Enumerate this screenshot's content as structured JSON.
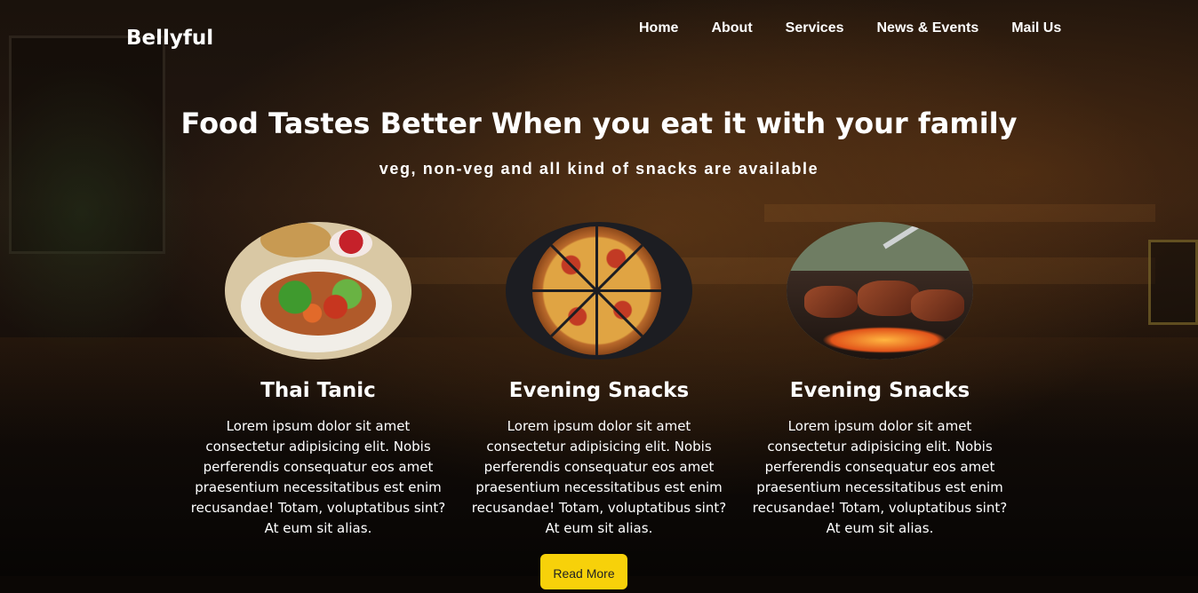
{
  "brand": {
    "name": "Bellyful"
  },
  "nav": {
    "items": [
      {
        "label": "Home"
      },
      {
        "label": "About"
      },
      {
        "label": "Services"
      },
      {
        "label": "News & Events"
      },
      {
        "label": "Mail Us"
      }
    ]
  },
  "hero": {
    "title": "Food Tastes Better When you eat it with your family",
    "subtitle": "veg, non-veg and all kind of snacks are available"
  },
  "cards": [
    {
      "title": "Thai Tanic",
      "description": "Lorem ipsum dolor sit amet consectetur adipisicing elit. Nobis perferendis consequatur eos amet praesentium necessitatibus est enim recusandae! Totam, voluptatibus sint? At eum sit alias."
    },
    {
      "title": "Evening Snacks",
      "description": "Lorem ipsum dolor sit amet consectetur adipisicing elit. Nobis perferendis consequatur eos amet praesentium necessitatibus est enim recusandae! Totam, voluptatibus sint? At eum sit alias."
    },
    {
      "title": "Evening Snacks",
      "description": "Lorem ipsum dolor sit amet consectetur adipisicing elit. Nobis perferendis consequatur eos amet praesentium necessitatibus est enim recusandae! Totam, voluptatibus sint? At eum sit alias."
    }
  ],
  "cta": {
    "label": "Read More"
  },
  "colors": {
    "accent": "#f7d10a",
    "text": "#ffffff"
  }
}
